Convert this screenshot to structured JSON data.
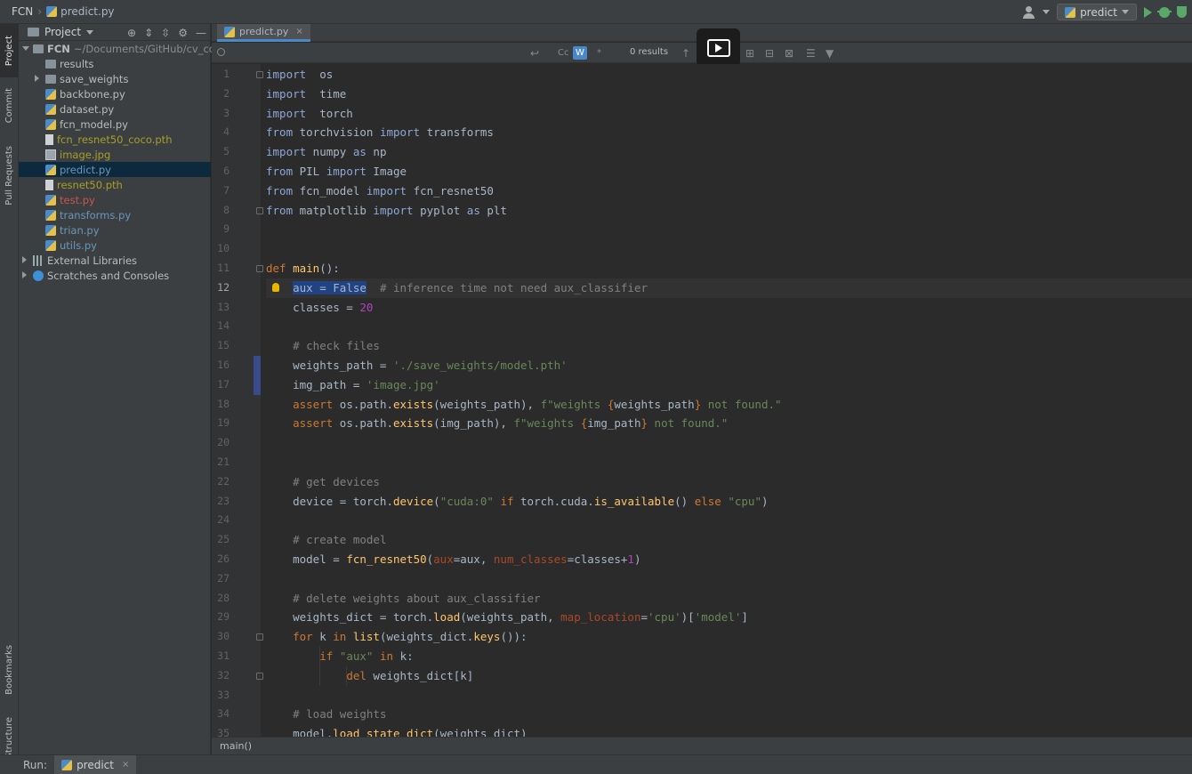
{
  "titlebar": {
    "project": "FCN",
    "file": "predict.py",
    "run_config": "predict"
  },
  "left_tools": {
    "project": "Project",
    "commit": "Commit",
    "pull_requests": "Pull Requests",
    "bookmarks": "Bookmarks",
    "structure": "Structure"
  },
  "project_panel": {
    "title": "Project",
    "tree": [
      {
        "label": "FCN",
        "sub": "~/Documents/GitHub/cv_collec",
        "type": "folder",
        "level": 0,
        "arrow": "down",
        "color": "normal"
      },
      {
        "label": "results",
        "type": "folder",
        "level": 1,
        "arrow": "none",
        "color": "normal"
      },
      {
        "label": "save_weights",
        "type": "folder",
        "level": 1,
        "arrow": "right",
        "color": "normal"
      },
      {
        "label": "backbone.py",
        "type": "py",
        "level": 1,
        "color": "normal"
      },
      {
        "label": "dataset.py",
        "type": "py",
        "level": 1,
        "color": "normal"
      },
      {
        "label": "fcn_model.py",
        "type": "py",
        "level": 1,
        "color": "normal"
      },
      {
        "label": "fcn_resnet50_coco.pth",
        "type": "file",
        "level": 1,
        "color": "yellow"
      },
      {
        "label": "image.jpg",
        "type": "img",
        "level": 1,
        "color": "yellow"
      },
      {
        "label": "predict.py",
        "type": "py",
        "level": 1,
        "color": "blue",
        "selected": true
      },
      {
        "label": "resnet50.pth",
        "type": "file",
        "level": 1,
        "color": "yellow"
      },
      {
        "label": "test.py",
        "type": "py",
        "level": 1,
        "color": "red"
      },
      {
        "label": "transforms.py",
        "type": "py",
        "level": 1,
        "color": "blue"
      },
      {
        "label": "trian.py",
        "type": "py",
        "level": 1,
        "color": "blue"
      },
      {
        "label": "utils.py",
        "type": "py",
        "level": 1,
        "color": "blue"
      },
      {
        "label": "External Libraries",
        "type": "lib",
        "level": 0,
        "arrow": "right",
        "color": "normal"
      },
      {
        "label": "Scratches and Consoles",
        "type": "scratch",
        "level": 0,
        "arrow": "right",
        "color": "normal"
      }
    ]
  },
  "editor_tab": {
    "label": "predict.py",
    "close": "×"
  },
  "search": {
    "value": "",
    "match_case": "Cc",
    "words": "W",
    "regex": "*",
    "results": "0 results"
  },
  "editor": {
    "current_line": 12,
    "lines": [
      [
        [
          "kw2",
          "import"
        ],
        [
          "",
          "  os"
        ]
      ],
      [
        [
          "kw2",
          "import"
        ],
        [
          "",
          "  time"
        ]
      ],
      [
        [
          "kw2",
          "import"
        ],
        [
          "",
          "  torch"
        ]
      ],
      [
        [
          "kw2",
          "from"
        ],
        [
          "",
          " torchvision "
        ],
        [
          "kw2",
          "import"
        ],
        [
          "",
          " transforms"
        ]
      ],
      [
        [
          "kw2",
          "import"
        ],
        [
          "",
          " numpy "
        ],
        [
          "kw2",
          "as"
        ],
        [
          "",
          " np"
        ]
      ],
      [
        [
          "kw2",
          "from"
        ],
        [
          "",
          " PIL "
        ],
        [
          "kw2",
          "import"
        ],
        [
          "",
          " Image"
        ]
      ],
      [
        [
          "kw2",
          "from"
        ],
        [
          "",
          " fcn_model "
        ],
        [
          "kw2",
          "import"
        ],
        [
          "",
          " fcn_resnet50"
        ]
      ],
      [
        [
          "kw2",
          "from"
        ],
        [
          "",
          " matplotlib "
        ],
        [
          "kw2",
          "import"
        ],
        [
          "",
          " pyplot "
        ],
        [
          "kw2",
          "as"
        ],
        [
          "",
          " plt"
        ]
      ],
      [],
      [],
      [
        [
          "kw",
          "def"
        ],
        [
          "",
          " "
        ],
        [
          "fn",
          "main"
        ],
        [
          "",
          "():"
        ]
      ],
      [
        [
          "",
          "    "
        ],
        [
          "sel",
          "aux = False"
        ],
        [
          "",
          "  "
        ],
        [
          "cmt",
          "# inference time not need aux_classifier"
        ]
      ],
      [
        [
          "",
          "    classes = "
        ],
        [
          "num",
          "20"
        ]
      ],
      [],
      [
        [
          "",
          "    "
        ],
        [
          "cmt",
          "# check files"
        ]
      ],
      [
        [
          "",
          "    weights_path = "
        ],
        [
          "str",
          "'./save_weights/model.pth'"
        ]
      ],
      [
        [
          "",
          "    img_path = "
        ],
        [
          "str",
          "'image.jpg'"
        ]
      ],
      [
        [
          "",
          "    "
        ],
        [
          "kw",
          "assert"
        ],
        [
          "",
          " os.path."
        ],
        [
          "fn",
          "exists"
        ],
        [
          "",
          "(weights_path), "
        ],
        [
          "str",
          "f\"weights "
        ],
        [
          "kw",
          "{"
        ],
        [
          "",
          "weights_path"
        ],
        [
          "kw",
          "}"
        ],
        [
          "str",
          " not found.\""
        ]
      ],
      [
        [
          "",
          "    "
        ],
        [
          "kw",
          "assert"
        ],
        [
          "",
          " os.path."
        ],
        [
          "fn",
          "exists"
        ],
        [
          "",
          "(img_path), "
        ],
        [
          "str",
          "f\"weights "
        ],
        [
          "kw",
          "{"
        ],
        [
          "",
          "img_path"
        ],
        [
          "kw",
          "}"
        ],
        [
          "str",
          " not found.\""
        ]
      ],
      [],
      [],
      [
        [
          "",
          "    "
        ],
        [
          "cmt",
          "# get devices"
        ]
      ],
      [
        [
          "",
          "    device = torch."
        ],
        [
          "fn",
          "device"
        ],
        [
          "",
          "("
        ],
        [
          "str",
          "\"cuda:0\""
        ],
        [
          "",
          " "
        ],
        [
          "kw",
          "if"
        ],
        [
          "",
          " torch.cuda."
        ],
        [
          "fn",
          "is_available"
        ],
        [
          "",
          "() "
        ],
        [
          "kw",
          "else"
        ],
        [
          "",
          " "
        ],
        [
          "str",
          "\"cpu\""
        ],
        [
          "",
          ")"
        ]
      ],
      [],
      [
        [
          "",
          "    "
        ],
        [
          "cmt",
          "# create model"
        ]
      ],
      [
        [
          "",
          "    model = "
        ],
        [
          "fn",
          "fcn_resnet50"
        ],
        [
          "",
          "("
        ],
        [
          "prm",
          "aux"
        ],
        [
          "",
          "=aux, "
        ],
        [
          "prm",
          "num_classes"
        ],
        [
          "",
          "=classes+"
        ],
        [
          "num",
          "1"
        ],
        [
          "",
          ")"
        ]
      ],
      [],
      [
        [
          "",
          "    "
        ],
        [
          "cmt",
          "# delete weights about aux_classifier"
        ]
      ],
      [
        [
          "",
          "    weights_dict = torch."
        ],
        [
          "fn",
          "load"
        ],
        [
          "",
          "(weights_path, "
        ],
        [
          "prm",
          "map_location"
        ],
        [
          "",
          "="
        ],
        [
          "str",
          "'cpu'"
        ],
        [
          "",
          ")["
        ],
        [
          "str",
          "'model'"
        ],
        [
          "",
          "]"
        ]
      ],
      [
        [
          "",
          "    "
        ],
        [
          "kw",
          "for"
        ],
        [
          "",
          " k "
        ],
        [
          "kw",
          "in"
        ],
        [
          "",
          " "
        ],
        [
          "fn",
          "list"
        ],
        [
          "",
          "(weights_dict."
        ],
        [
          "fn",
          "keys"
        ],
        [
          "",
          "()):"
        ]
      ],
      [
        [
          "",
          "        "
        ],
        [
          "kw",
          "if"
        ],
        [
          "",
          " "
        ],
        [
          "str",
          "\"aux\""
        ],
        [
          "",
          " "
        ],
        [
          "kw",
          "in"
        ],
        [
          "",
          " k:"
        ]
      ],
      [
        [
          "",
          "            "
        ],
        [
          "kw",
          "del"
        ],
        [
          "",
          " weights_dict[k]"
        ]
      ],
      [],
      [
        [
          "",
          "    "
        ],
        [
          "cmt",
          "# load weights"
        ]
      ],
      [
        [
          "",
          "    model."
        ],
        [
          "fn",
          "load_state_dict"
        ],
        [
          "",
          "(weights_dict)"
        ]
      ]
    ]
  },
  "breadcrumb": "main()",
  "runbar": {
    "label": "Run:",
    "tab": "predict"
  }
}
